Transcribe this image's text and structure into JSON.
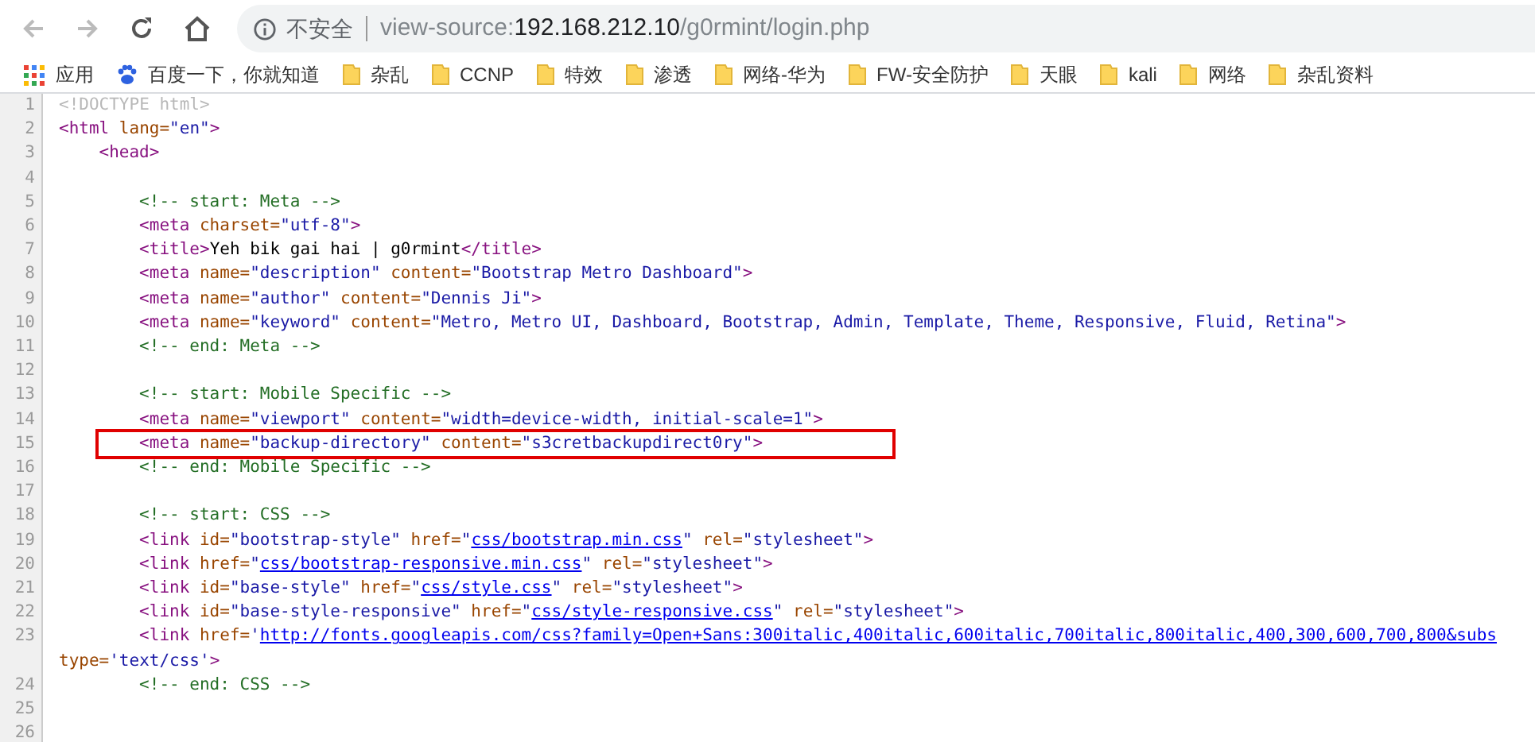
{
  "browser": {
    "address": {
      "security": "不安全",
      "scheme": "view-source:",
      "host": "192.168.212.10",
      "path": "/g0rmint/login.php"
    },
    "bookmarks": [
      {
        "kind": "apps",
        "label": "应用"
      },
      {
        "kind": "paw",
        "label": "百度一下，你就知道"
      },
      {
        "kind": "folder",
        "label": "杂乱"
      },
      {
        "kind": "folder",
        "label": "CCNP"
      },
      {
        "kind": "folder",
        "label": "特效"
      },
      {
        "kind": "folder",
        "label": "渗透"
      },
      {
        "kind": "folder",
        "label": "网络-华为"
      },
      {
        "kind": "folder",
        "label": "FW-安全防护"
      },
      {
        "kind": "folder",
        "label": "天眼"
      },
      {
        "kind": "folder",
        "label": "kali"
      },
      {
        "kind": "folder",
        "label": "网络"
      },
      {
        "kind": "folder",
        "label": "杂乱资料"
      }
    ]
  },
  "source": {
    "lines": [
      {
        "number": "1",
        "highlighted": false,
        "tokens": [
          {
            "kind": "doctype",
            "text": "<!DOCTYPE html>"
          }
        ]
      },
      {
        "number": "2",
        "highlighted": false,
        "tokens": [
          {
            "kind": "tag",
            "text": "<html"
          },
          {
            "kind": "attr",
            "text": " lang="
          },
          {
            "kind": "value",
            "text": "\"en\""
          },
          {
            "kind": "tag",
            "text": ">"
          }
        ],
        "children": [
          {
            "number": "3",
            "highlighted": false,
            "tokens": [
              {
                "kind": "tag",
                "text": "<head>"
              }
            ],
            "children": [
              {
                "number": "4",
                "highlighted": false
              },
              {
                "number": "5",
                "highlighted": false,
                "tokens": [
                  {
                    "kind": "comment",
                    "text": "<!-- start: Meta -->"
                  }
                ]
              },
              {
                "number": "6",
                "highlighted": false,
                "tokens": [
                  {
                    "kind": "tag",
                    "text": "<meta"
                  },
                  {
                    "kind": "attr",
                    "text": " charset="
                  },
                  {
                    "kind": "value",
                    "text": "\"utf-8\""
                  },
                  {
                    "kind": "tag",
                    "text": ">"
                  }
                ]
              },
              {
                "number": "7",
                "highlighted": false,
                "tokens": [
                  {
                    "kind": "tag",
                    "text": "<title>"
                  },
                  {
                    "kind": "text",
                    "text": "Yeh bik gai hai | g0rmint"
                  },
                  {
                    "kind": "tag",
                    "text": "</title>"
                  }
                ]
              },
              {
                "number": "8",
                "highlighted": false,
                "tokens": [
                  {
                    "kind": "tag",
                    "text": "<meta"
                  },
                  {
                    "kind": "attr",
                    "text": " name="
                  },
                  {
                    "kind": "value",
                    "text": "\"description\""
                  },
                  {
                    "kind": "attr",
                    "text": " content="
                  },
                  {
                    "kind": "value",
                    "text": "\"Bootstrap Metro Dashboard\""
                  },
                  {
                    "kind": "tag",
                    "text": ">"
                  }
                ]
              },
              {
                "number": "9",
                "highlighted": false,
                "tokens": [
                  {
                    "kind": "tag",
                    "text": "<meta"
                  },
                  {
                    "kind": "attr",
                    "text": " name="
                  },
                  {
                    "kind": "value",
                    "text": "\"author\""
                  },
                  {
                    "kind": "attr",
                    "text": " content="
                  },
                  {
                    "kind": "value",
                    "text": "\"Dennis Ji\""
                  },
                  {
                    "kind": "tag",
                    "text": ">"
                  }
                ]
              },
              {
                "number": "10",
                "highlighted": false,
                "tokens": [
                  {
                    "kind": "tag",
                    "text": "<meta"
                  },
                  {
                    "kind": "attr",
                    "text": " name="
                  },
                  {
                    "kind": "value",
                    "text": "\"keyword\""
                  },
                  {
                    "kind": "attr",
                    "text": " content="
                  },
                  {
                    "kind": "value",
                    "text": "\"Metro, Metro UI, Dashboard, Bootstrap, Admin, Template, Theme, Responsive, Fluid, Retina\""
                  },
                  {
                    "kind": "tag",
                    "text": ">"
                  }
                ]
              },
              {
                "number": "11",
                "highlighted": false,
                "tokens": [
                  {
                    "kind": "comment",
                    "text": "<!-- end: Meta -->"
                  }
                ]
              },
              {
                "number": "12",
                "highlighted": false
              },
              {
                "number": "13",
                "highlighted": false,
                "tokens": [
                  {
                    "kind": "comment",
                    "text": "<!-- start: Mobile Specific -->"
                  }
                ]
              },
              {
                "number": "14",
                "highlighted": false,
                "tokens": [
                  {
                    "kind": "tag",
                    "text": "<meta"
                  },
                  {
                    "kind": "attr",
                    "text": " name="
                  },
                  {
                    "kind": "value",
                    "text": "\"viewport\""
                  },
                  {
                    "kind": "attr",
                    "text": " content="
                  },
                  {
                    "kind": "value",
                    "text": "\"width=device-width, initial-scale=1\""
                  },
                  {
                    "kind": "tag",
                    "text": ">"
                  }
                ]
              },
              {
                "number": "15",
                "highlighted": true,
                "tokens": [
                  {
                    "kind": "tag",
                    "text": "<meta"
                  },
                  {
                    "kind": "attr",
                    "text": " name="
                  },
                  {
                    "kind": "value",
                    "text": "\"backup-directory\""
                  },
                  {
                    "kind": "attr",
                    "text": " content="
                  },
                  {
                    "kind": "value",
                    "text": "\"s3cretbackupdirect0ry\""
                  },
                  {
                    "kind": "tag",
                    "text": ">"
                  }
                ]
              },
              {
                "number": "16",
                "highlighted": false,
                "tokens": [
                  {
                    "kind": "comment",
                    "text": "<!-- end: Mobile Specific -->"
                  }
                ]
              },
              {
                "number": "17",
                "highlighted": false
              },
              {
                "number": "18",
                "highlighted": false,
                "tokens": [
                  {
                    "kind": "comment",
                    "text": "<!-- start: CSS -->"
                  }
                ]
              },
              {
                "number": "19",
                "highlighted": false,
                "tokens": [
                  {
                    "kind": "tag",
                    "text": "<link"
                  },
                  {
                    "kind": "attr",
                    "text": " id="
                  },
                  {
                    "kind": "value",
                    "text": "\"bootstrap-style\""
                  },
                  {
                    "kind": "attr",
                    "text": " href="
                  },
                  {
                    "kind": "value",
                    "text": "\""
                  },
                  {
                    "kind": "link",
                    "text": "css/bootstrap.min.css"
                  },
                  {
                    "kind": "value",
                    "text": "\""
                  },
                  {
                    "kind": "attr",
                    "text": " rel="
                  },
                  {
                    "kind": "value",
                    "text": "\"stylesheet\""
                  },
                  {
                    "kind": "tag",
                    "text": ">"
                  }
                ]
              },
              {
                "number": "20",
                "highlighted": false,
                "tokens": [
                  {
                    "kind": "tag",
                    "text": "<link"
                  },
                  {
                    "kind": "attr",
                    "text": " href="
                  },
                  {
                    "kind": "value",
                    "text": "\""
                  },
                  {
                    "kind": "link",
                    "text": "css/bootstrap-responsive.min.css"
                  },
                  {
                    "kind": "value",
                    "text": "\""
                  },
                  {
                    "kind": "attr",
                    "text": " rel="
                  },
                  {
                    "kind": "value",
                    "text": "\"stylesheet\""
                  },
                  {
                    "kind": "tag",
                    "text": ">"
                  }
                ]
              },
              {
                "number": "21",
                "highlighted": false,
                "tokens": [
                  {
                    "kind": "tag",
                    "text": "<link"
                  },
                  {
                    "kind": "attr",
                    "text": " id="
                  },
                  {
                    "kind": "value",
                    "text": "\"base-style\""
                  },
                  {
                    "kind": "attr",
                    "text": " href="
                  },
                  {
                    "kind": "value",
                    "text": "\""
                  },
                  {
                    "kind": "link",
                    "text": "css/style.css"
                  },
                  {
                    "kind": "value",
                    "text": "\""
                  },
                  {
                    "kind": "attr",
                    "text": " rel="
                  },
                  {
                    "kind": "value",
                    "text": "\"stylesheet\""
                  },
                  {
                    "kind": "tag",
                    "text": ">"
                  }
                ]
              },
              {
                "number": "22",
                "highlighted": false,
                "tokens": [
                  {
                    "kind": "tag",
                    "text": "<link"
                  },
                  {
                    "kind": "attr",
                    "text": " id="
                  },
                  {
                    "kind": "value",
                    "text": "\"base-style-responsive\""
                  },
                  {
                    "kind": "attr",
                    "text": " href="
                  },
                  {
                    "kind": "value",
                    "text": "\""
                  },
                  {
                    "kind": "link",
                    "text": "css/style-responsive.css"
                  },
                  {
                    "kind": "value",
                    "text": "\""
                  },
                  {
                    "kind": "attr",
                    "text": " rel="
                  },
                  {
                    "kind": "value",
                    "text": "\"stylesheet\""
                  },
                  {
                    "kind": "tag",
                    "text": ">"
                  }
                ]
              },
              {
                "number": "23",
                "highlighted": false,
                "tokens": [
                  {
                    "kind": "tag",
                    "text": "<link"
                  },
                  {
                    "kind": "attr",
                    "text": " href="
                  },
                  {
                    "kind": "value",
                    "text": "'"
                  },
                  {
                    "kind": "link",
                    "text": "http://fonts.googleapis.com/css?family=Open+Sans:300italic,400italic,600italic,700italic,800italic,400,300,600,700,800&subs"
                  }
                ],
                "continuation": [
                  {
                    "kind": "attr",
                    "text": "type="
                  },
                  {
                    "kind": "value",
                    "text": "'text/css'"
                  },
                  {
                    "kind": "tag",
                    "text": ">"
                  }
                ]
              },
              {
                "number": "24",
                "highlighted": false,
                "tokens": [
                  {
                    "kind": "comment",
                    "text": "<!-- end: CSS -->"
                  }
                ]
              },
              {
                "number": "25",
                "highlighted": false
              },
              {
                "number": "26",
                "highlighted": false
              }
            ]
          }
        ]
      }
    ]
  }
}
